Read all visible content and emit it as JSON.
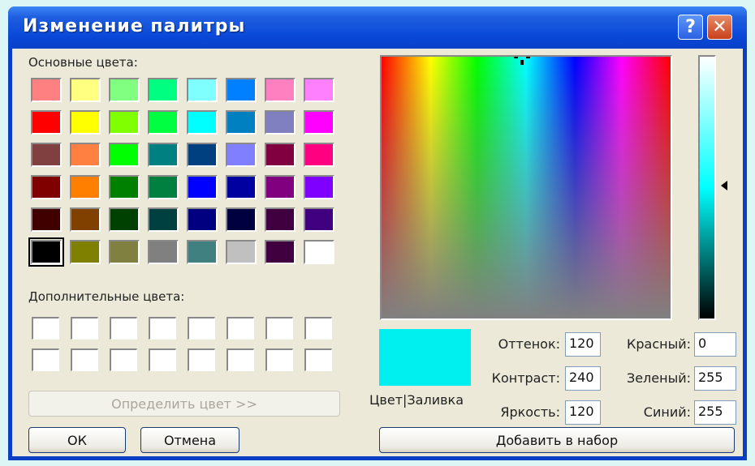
{
  "window": {
    "title": "Изменение палитры",
    "help_label": "?",
    "close_label": "✕"
  },
  "basic": {
    "label": "Основные цвета:",
    "colors": [
      [
        "#ff8080",
        "#ffff80",
        "#80ff80",
        "#00ff80",
        "#80ffff",
        "#0080ff",
        "#ff80c0",
        "#ff80ff"
      ],
      [
        "#ff0000",
        "#ffff00",
        "#80ff00",
        "#00ff40",
        "#00ffff",
        "#0080c0",
        "#8080c0",
        "#ff00ff"
      ],
      [
        "#804040",
        "#ff8040",
        "#00ff00",
        "#008080",
        "#004080",
        "#8080ff",
        "#800040",
        "#ff0080"
      ],
      [
        "#800000",
        "#ff8000",
        "#008000",
        "#008040",
        "#0000ff",
        "#0000a0",
        "#800080",
        "#8000ff"
      ],
      [
        "#400000",
        "#804000",
        "#004000",
        "#004040",
        "#000080",
        "#000040",
        "#400040",
        "#400080"
      ],
      [
        "#000000",
        "#808000",
        "#808040",
        "#808080",
        "#408080",
        "#c0c0c0",
        "#400040",
        "#ffffff"
      ]
    ],
    "selected": "#000000"
  },
  "custom": {
    "label": "Дополнительные цвета:"
  },
  "buttons": {
    "define": "Определить цвет >>",
    "ok": "ОК",
    "cancel": "Отмена",
    "add": "Добавить в набор"
  },
  "preview": {
    "label": "Цвет|Заливка",
    "color": "#00f0f0"
  },
  "hsl": {
    "hue_label": "Оттенок:",
    "hue": "120",
    "sat_label": "Контраст:",
    "sat": "240",
    "lum_label": "Яркость:",
    "lum": "120"
  },
  "rgb": {
    "red_label": "Красный:",
    "red": "0",
    "green_label": "Зеленый:",
    "green": "255",
    "blue_label": "Синий:",
    "blue": "255"
  }
}
